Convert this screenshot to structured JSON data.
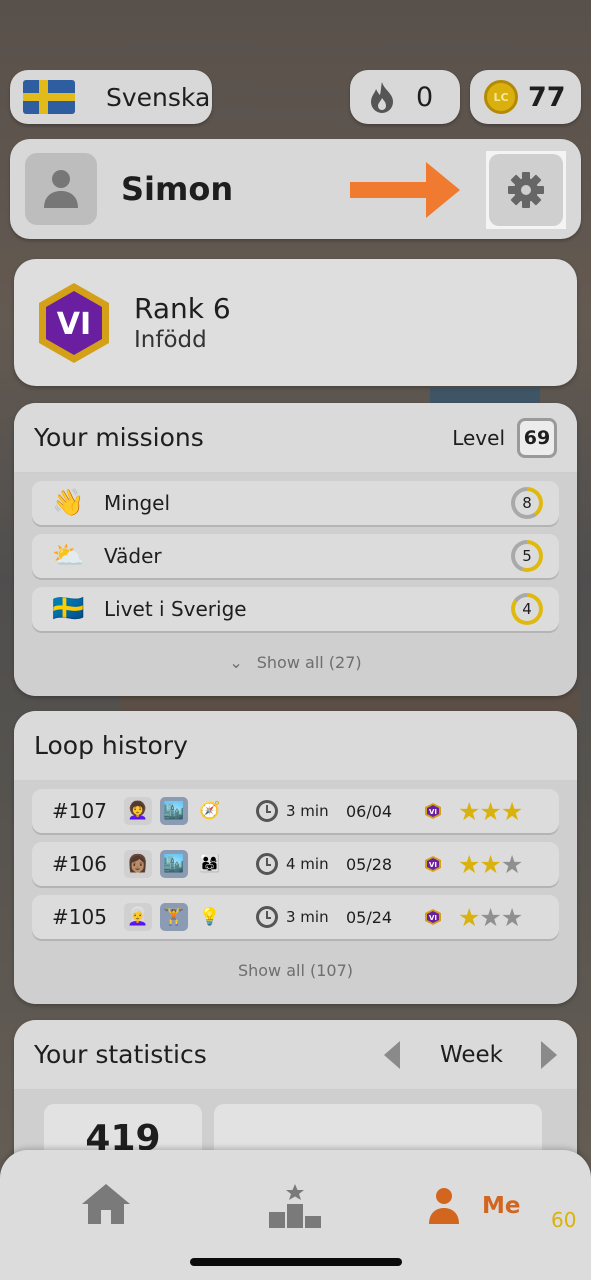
{
  "topbar": {
    "language": "Svenska",
    "flag_icon": "sweden-flag-icon",
    "streak_count": "0",
    "streak_icon": "flame-icon",
    "coins_count": "77",
    "coin_icon": "lc-coin-icon",
    "coin_symbol": "LC"
  },
  "profile": {
    "name": "Simon",
    "avatar_icon": "person-icon",
    "settings_icon": "gear-icon",
    "annotation_icon": "arrow-right-icon",
    "annotation_color": "#f07a30"
  },
  "rank": {
    "badge": "VI",
    "title": "Rank 6",
    "subtitle": "Infödd",
    "badge_colors": {
      "fill": "#6a1fa0",
      "border": "#d4a017"
    }
  },
  "missions": {
    "title": "Your missions",
    "level_label": "Level",
    "level_value": "69",
    "items": [
      {
        "icon": "👋",
        "icon_name": "waving-hand-icon",
        "label": "Mingel",
        "count": "8",
        "progress": 0.4
      },
      {
        "icon": "⛅",
        "icon_name": "sun-behind-cloud-icon",
        "label": "Väder",
        "count": "5",
        "progress": 0.55
      },
      {
        "icon": "🇸🇪",
        "icon_name": "sweden-flag-icon",
        "label": "Livet i Sverige",
        "count": "4",
        "progress": 0.85
      }
    ],
    "show_all": "Show all (27)"
  },
  "loop_history": {
    "title": "Loop history",
    "items": [
      {
        "num": "#107",
        "icons": [
          "👩‍🦱",
          "🏙️",
          "🧭"
        ],
        "icon_names": [
          "character-avatar-icon",
          "city-icon",
          "compass-icon"
        ],
        "duration": "3 min",
        "date": "06/04",
        "badge": "VI",
        "stars": 3
      },
      {
        "num": "#106",
        "icons": [
          "👩🏽",
          "🏙️",
          "👨‍👩‍👧"
        ],
        "icon_names": [
          "character-avatar-icon",
          "city-icon",
          "family-icon"
        ],
        "duration": "4 min",
        "date": "05/28",
        "badge": "VI",
        "stars": 2
      },
      {
        "num": "#105",
        "icons": [
          "👩‍🦳",
          "🏋️",
          "💡"
        ],
        "icon_names": [
          "character-avatar-icon",
          "dumbbell-icon",
          "light-bulb-icon"
        ],
        "duration": "3 min",
        "date": "05/24",
        "badge": "VI",
        "stars": 1
      }
    ],
    "show_all": "Show all (107)"
  },
  "statistics": {
    "title": "Your statistics",
    "period": "Week",
    "value": "419"
  },
  "bottom_nav": {
    "home_icon": "home-icon",
    "leaderboard_icon": "podium-icon",
    "me_icon": "person-icon",
    "me_label": "Me",
    "me_color": "#d2661e",
    "corner_number": "60"
  }
}
